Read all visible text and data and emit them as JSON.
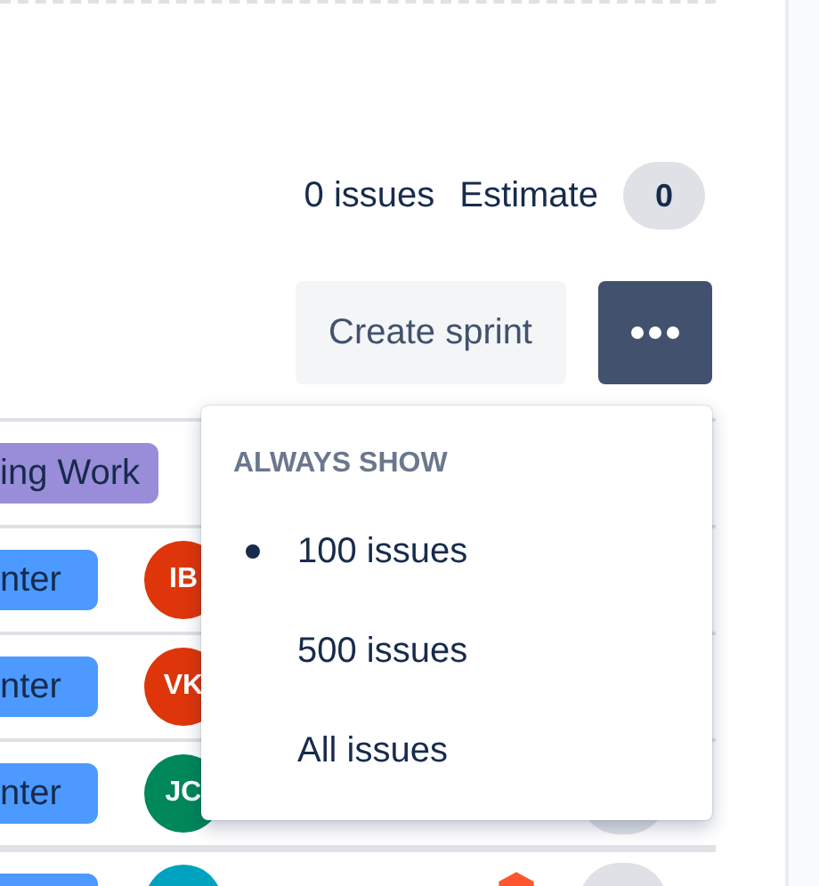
{
  "summary": {
    "issues": "0 issues",
    "estimate_label": "Estimate",
    "estimate": "0"
  },
  "actions": {
    "create": "Create sprint"
  },
  "rows": [
    {
      "epic": {
        "text": "ing Work",
        "color": "#998dd9"
      }
    },
    {
      "epic": {
        "text": "nter",
        "color": "#4c9aff"
      },
      "assignee": {
        "initials": "IB",
        "color": "#de350b"
      }
    },
    {
      "epic": {
        "text": "nter",
        "color": "#4c9aff"
      },
      "assignee": {
        "initials": "VK",
        "color": "#de350b"
      }
    },
    {
      "epic": {
        "text": "nter",
        "color": "#4c9aff"
      },
      "assignee": {
        "initials": "JC",
        "color": "#00875a"
      },
      "estimate_pill": true
    },
    {
      "epic": {
        "color": "#4c9aff"
      },
      "assignee": {
        "color": "#00a3bf"
      },
      "estimate_pill": true,
      "priority_icon": true
    }
  ],
  "menu": {
    "heading": "ALWAYS SHOW",
    "options": [
      {
        "label": "100 issues",
        "selected": true
      },
      {
        "label": "500 issues",
        "selected": false
      },
      {
        "label": "All issues",
        "selected": false
      }
    ]
  }
}
